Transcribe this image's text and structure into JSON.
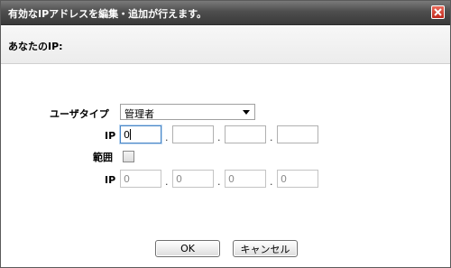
{
  "dialog": {
    "title": "有効なIPアドレスを編集・追加が行えます。",
    "close_icon": "close-icon"
  },
  "info": {
    "label": "あなたのIP:",
    "value": ""
  },
  "form": {
    "user_type_label": "ユーザタイプ",
    "user_type_value": "管理者",
    "ip_label": "IP",
    "ip_values": [
      "0",
      "",
      "",
      ""
    ],
    "range_label": "範囲",
    "range_checked": false,
    "range_ip_label": "IP",
    "range_ip_values": [
      "0",
      "0",
      "0",
      "0"
    ],
    "dot": "."
  },
  "buttons": {
    "ok_label": "OK",
    "cancel_label": "キャンセル"
  },
  "colors": {
    "titlebar": "#4e4e4e",
    "close": "#c0281c",
    "focus": "#4a87c7"
  }
}
